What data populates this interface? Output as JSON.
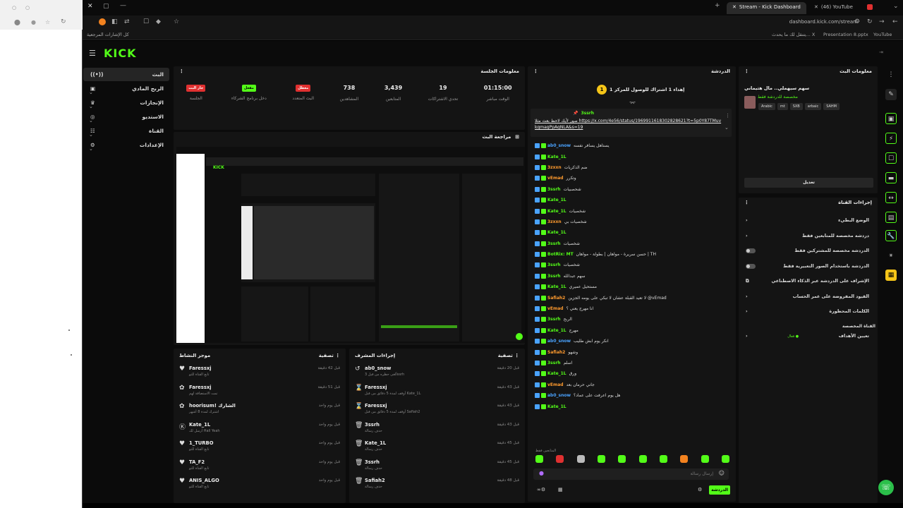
{
  "browser": {
    "tabs": [
      {
        "title": "Stream - Kick Dashboard",
        "active": true
      },
      {
        "title": "(46) YouTube",
        "active": false
      }
    ],
    "url": "dashboard.kick.com/stream",
    "bookmarks": [
      "YouTube",
      "Presentation 8.pptx",
      "يتنقل لك ما يحدث... X",
      "كل الإشارات المرجعية"
    ]
  },
  "kick": {
    "logo": "KICK",
    "nav": [
      {
        "label": "البث",
        "active": true
      },
      {
        "label": "الربح المادي"
      },
      {
        "label": "الإنجازات"
      },
      {
        "label": "الاستديو"
      },
      {
        "label": "القناة"
      },
      {
        "label": "الإعدادات"
      }
    ]
  },
  "session": {
    "title": "معلومات الجلسة",
    "stats": [
      {
        "badge": "جار البث",
        "label": "الجلسة",
        "color": "#e03030"
      },
      {
        "badge": "مفعل",
        "label": "دخل برنامج الشركاء",
        "color": "#53fc18"
      },
      {
        "badge": "معطل",
        "label": "البث المتعدد",
        "color": "#e03030"
      },
      {
        "value": "738",
        "label": "المشاهدين"
      },
      {
        "value": "3,439",
        "label": "المتابعين"
      },
      {
        "value": "19",
        "label": "تحدي الاشتراكات"
      },
      {
        "value": "01:15:00",
        "label": "الوقت مباشر"
      }
    ]
  },
  "preview": {
    "title": "مراجعة البث"
  },
  "activity": {
    "title": "موجز النشاط",
    "filter": "تصفية",
    "items": [
      {
        "icon": "heart-icon",
        "name": "Faressxj",
        "sub": "تابع القناة للتو",
        "time": "قبل 42 دقيقة"
      },
      {
        "icon": "gift-icon",
        "name": "Faressxj",
        "sub": "تمت الاستضافة لهم",
        "time": "قبل 51 دقيقة"
      },
      {
        "icon": "gift-icon",
        "name": "hoorisum! الشارك",
        "sub": "اشترك لمدة 8 أشهر",
        "time": "قبل يوم واحد"
      },
      {
        "icon": "kick-icon",
        "name": "Kate_1L",
        "sub": "أرسل لك Hall Yeah",
        "time": "قبل يوم واحد"
      },
      {
        "icon": "heart-icon",
        "name": "1_TURBO",
        "sub": "تابع القناة للتو",
        "time": "قبل يوم واحد"
      },
      {
        "icon": "heart-icon",
        "name": "TA_F2",
        "sub": "تابع القناة للتو",
        "time": "قبل يوم واحد"
      },
      {
        "icon": "heart-icon",
        "name": "ANIS_ALGO",
        "sub": "تابع القناة للتو",
        "time": "قبل يوم واحد"
      }
    ]
  },
  "modactions": {
    "title": "إجراءات المشرف",
    "filter": "تصفية",
    "items": [
      {
        "icon": "undo-icon",
        "name": "ab0_snow",
        "sub": "ألغى حظره من قبل 3ssrh",
        "time": "قبل 20 دقيقة"
      },
      {
        "icon": "hourglass-icon",
        "name": "Faressxj",
        "sub": "أوقف لمدة 5 دقائق من قبل Kate_1L",
        "time": "قبل 43 دقيقة"
      },
      {
        "icon": "hourglass-icon",
        "name": "Faressxj",
        "sub": "أوقف لمدة 5 دقائق من قبل Safiah2",
        "time": "قبل 43 دقيقة"
      },
      {
        "icon": "trash-icon",
        "name": "3ssrh",
        "sub": "حذف رسالة",
        "time": "قبل 43 دقيقة"
      },
      {
        "icon": "trash-icon",
        "name": "Kate_1L",
        "sub": "حذف رسالة",
        "time": "قبل 45 دقيقة"
      },
      {
        "icon": "trash-icon",
        "name": "3ssrh",
        "sub": "حذف رسالة",
        "time": "قبل 45 دقيقة"
      },
      {
        "icon": "trash-icon",
        "name": "Safiah2",
        "sub": "حذف رسالة",
        "time": "قبل 48 دقيقة"
      }
    ]
  },
  "chat": {
    "title": "الدردشة",
    "goal": "إهداء 1 اشتراك للوصول للمركز 1",
    "goal_rank": "1",
    "pinned_user": "3ssrh",
    "pinned_text": "صور لأيك لاحظ بعث مثلا https://x.com/4e56/status/1969911618302828621?t=5p0Y87TMuvkqmagPpAqNLA&s=19",
    "messages": [
      {
        "user": "ab0_snow",
        "color": "#4aa3ff",
        "text": "يستاهل يسافر نفسه"
      },
      {
        "user": "Kate_1L",
        "color": "#53fc18",
        "text": ""
      },
      {
        "user": "3zxxn",
        "color": "#ff9a2e",
        "text": "ضم الذكريات"
      },
      {
        "user": "vEmad",
        "color": "#ff9a2e",
        "text": "وتكرر"
      },
      {
        "user": "3ssrh",
        "color": "#53fc18",
        "text": "شحصبيات"
      },
      {
        "user": "Kate_1L",
        "color": "#53fc18",
        "text": ""
      },
      {
        "user": "Kate_1L",
        "color": "#53fc18",
        "text": "شخصيات"
      },
      {
        "user": "3zxxn",
        "color": "#ff9a2e",
        "text": "شخصيات بي"
      },
      {
        "user": "Kate_1L",
        "color": "#53fc18",
        "text": ""
      },
      {
        "user": "3ssrh",
        "color": "#53fc18",
        "text": "شخصيات"
      },
      {
        "user": "BotRix: MT",
        "color": "#53fc18",
        "text": "حسن سريرة - مواهان | بطولة - مواهان | TH"
      },
      {
        "user": "3ssrh",
        "color": "#53fc18",
        "text": "شخصيات"
      },
      {
        "user": "3ssrh",
        "color": "#53fc18",
        "text": "سهم عبدالله"
      },
      {
        "user": "Kate_1L",
        "color": "#53fc18",
        "text": "مستحيل عميري"
      },
      {
        "user": "Safiah2",
        "color": "#ff9a2e",
        "text": "لا تعيد القبلة عشان لا تبكي على يومه الجزين @vEmad"
      },
      {
        "user": "vEmad",
        "color": "#ff9a2e",
        "text": "انا مهرج يعني ؟"
      },
      {
        "user": "3ssrh",
        "color": "#53fc18",
        "text": "الربح"
      },
      {
        "user": "Kate_1L",
        "color": "#53fc18",
        "text": "مهرج"
      },
      {
        "user": "ab0_snow",
        "color": "#4aa3ff",
        "text": "انكر يوم ابش طليب"
      },
      {
        "user": "Safiah2",
        "color": "#ff9a2e",
        "text": "وشهو"
      },
      {
        "user": "3ssrh",
        "color": "#53fc18",
        "text": "اسلم"
      },
      {
        "user": "Kate_1L",
        "color": "#53fc18",
        "text": "ورق"
      },
      {
        "user": "vEmad",
        "color": "#ff9a2e",
        "text": "جاني حرمان بعد"
      },
      {
        "user": "ab0_snow",
        "color": "#4aa3ff",
        "text": "هل يوم اعرفت على عماد؟"
      },
      {
        "user": "Kate_1L",
        "color": "#53fc18",
        "text": ""
      }
    ],
    "input_placeholder": "إرسال رسالة",
    "send_label": "الدردشة",
    "mode_label": "المتابعين فقط"
  },
  "stream_info": {
    "title": "معلومات البث",
    "stream_title": "سهم سيهملي.. مال هثيماني",
    "category": "مخصصة للدردشة فقط",
    "tags": [
      "Arabic",
      "mt",
      "SXB",
      "arbaic",
      "SAHM"
    ],
    "edit_label": "تعديل"
  },
  "channel_actions": {
    "title": "إجراءات القناة",
    "rows": [
      {
        "label": "الوضع البطيء",
        "control": "chevron"
      },
      {
        "label": "دردشة مخصصة للمتابعين فقط",
        "control": "chevron"
      },
      {
        "label": "الدردشة مخصصة للمشتركين فقط",
        "control": "toggle"
      },
      {
        "label": "الدردشة باستخدام الصور التعبيرية فقط",
        "control": "toggle"
      },
      {
        "label": "الإشراف على الدردشة عبر الذكاء الاصطناعي",
        "control": "external"
      },
      {
        "label": "القيود المفروضة على عمر الحساب",
        "control": "chevron"
      },
      {
        "label": "الكلمات المحظورة",
        "control": "chevron"
      }
    ],
    "shortcut_header": "القناة المخصصة",
    "target_label": "تعيين الأهداف",
    "target_status": "فعال ●"
  },
  "colors": {
    "accent": "#53fc18",
    "live": "#e03030"
  }
}
